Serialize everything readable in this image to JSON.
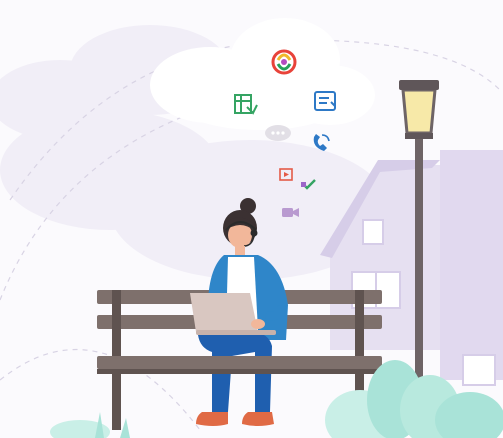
{
  "colors": {
    "sky": "#f6f4fb",
    "cloud": "#ffffff",
    "house": "#e6e0f1",
    "house_trim": "#d6cde8",
    "bench_wood": "#7e706c",
    "bench_dark": "#5f5350",
    "lamp_glass": "#f7e9a8",
    "lamp_post": "#6e6466",
    "shirt": "#2f86c9",
    "jeans": "#1f5faf",
    "shoes": "#e06a45",
    "skin": "#f2b79a",
    "hair": "#3b3132",
    "laptop": "#d9c7c1",
    "bush": "#a9e3d8",
    "bush_light": "#c9efe7"
  },
  "icons": [
    "logo-swirl-icon",
    "spreadsheet-icon",
    "document-icon",
    "chat-bubble-icon",
    "phone-call-icon",
    "media-player-icon",
    "checkmark-icon",
    "video-camera-icon"
  ]
}
